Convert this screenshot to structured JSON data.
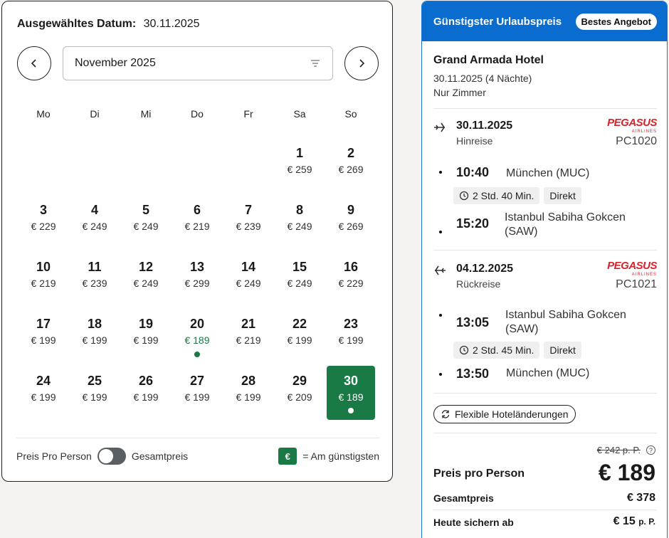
{
  "calendar": {
    "selected_label": "Ausgewähltes Datum:",
    "selected_value": "30.11.2025",
    "month": "November 2025",
    "weekdays": [
      "Mo",
      "Di",
      "Mi",
      "Do",
      "Fr",
      "Sa",
      "So"
    ],
    "days": [
      {
        "n": "",
        "p": ""
      },
      {
        "n": "",
        "p": ""
      },
      {
        "n": "",
        "p": ""
      },
      {
        "n": "",
        "p": ""
      },
      {
        "n": "",
        "p": ""
      },
      {
        "n": "1",
        "p": "€ 259"
      },
      {
        "n": "2",
        "p": "€ 269"
      },
      {
        "n": "3",
        "p": "€ 229"
      },
      {
        "n": "4",
        "p": "€ 249"
      },
      {
        "n": "5",
        "p": "€ 249"
      },
      {
        "n": "6",
        "p": "€ 219"
      },
      {
        "n": "7",
        "p": "€ 239"
      },
      {
        "n": "8",
        "p": "€ 249"
      },
      {
        "n": "9",
        "p": "€ 269"
      },
      {
        "n": "10",
        "p": "€ 219"
      },
      {
        "n": "11",
        "p": "€ 239"
      },
      {
        "n": "12",
        "p": "€ 249"
      },
      {
        "n": "13",
        "p": "€ 299"
      },
      {
        "n": "14",
        "p": "€ 249"
      },
      {
        "n": "15",
        "p": "€ 249"
      },
      {
        "n": "16",
        "p": "€ 229"
      },
      {
        "n": "17",
        "p": "€ 199"
      },
      {
        "n": "18",
        "p": "€ 199"
      },
      {
        "n": "19",
        "p": "€ 199"
      },
      {
        "n": "20",
        "p": "€ 189",
        "cheap": true
      },
      {
        "n": "21",
        "p": "€ 219"
      },
      {
        "n": "22",
        "p": "€ 199"
      },
      {
        "n": "23",
        "p": "€ 199"
      },
      {
        "n": "24",
        "p": "€ 199"
      },
      {
        "n": "25",
        "p": "€ 199"
      },
      {
        "n": "26",
        "p": "€ 199"
      },
      {
        "n": "27",
        "p": "€ 199"
      },
      {
        "n": "28",
        "p": "€ 199"
      },
      {
        "n": "29",
        "p": "€ 209"
      },
      {
        "n": "30",
        "p": "€ 189",
        "selected": true
      }
    ],
    "footer": {
      "per_person": "Preis Pro Person",
      "total": "Gesamtpreis",
      "legend_symbol": "€",
      "legend_text": "= Am günstigsten"
    }
  },
  "offer": {
    "header_title": "Günstigster Urlaubspreis",
    "badge": "Bestes Angebot",
    "hotel_name": "Grand Armada Hotel",
    "hotel_dates": "30.11.2025 (4 Nächte)",
    "hotel_board": "Nur Zimmer",
    "outbound": {
      "date": "30.11.2025",
      "type": "Hinreise",
      "airline": "PEGASUS",
      "airline_sub": "AIRLINES",
      "flight_no": "PC1020",
      "dep_time": "10:40",
      "dep_place": "München (MUC)",
      "duration": "2 Std. 40 Min.",
      "stops": "Direkt",
      "arr_time": "15:20",
      "arr_place": "Istanbul Sabiha Gokcen (SAW)"
    },
    "inbound": {
      "date": "04.12.2025",
      "type": "Rückreise",
      "airline": "PEGASUS",
      "airline_sub": "AIRLINES",
      "flight_no": "PC1021",
      "dep_time": "13:05",
      "dep_place": "Istanbul Sabiha Gokcen (SAW)",
      "duration": "2 Std. 45 Min.",
      "stops": "Direkt",
      "arr_time": "13:50",
      "arr_place": "München (MUC)"
    },
    "flex_button": "Flexible Hoteländerungen",
    "old_price": "€ 242 p. P.",
    "pp_label": "Preis pro Person",
    "pp_value": "€ 189",
    "total_label": "Gesamtpreis",
    "total_value": "€ 378",
    "deposit_label": "Heute sichern ab",
    "deposit_value": "€ 15",
    "deposit_unit": "p. P."
  },
  "colors": {
    "accent_green": "#1a7a45",
    "accent_blue": "#0a6cce",
    "airline_red": "#d6232a"
  }
}
